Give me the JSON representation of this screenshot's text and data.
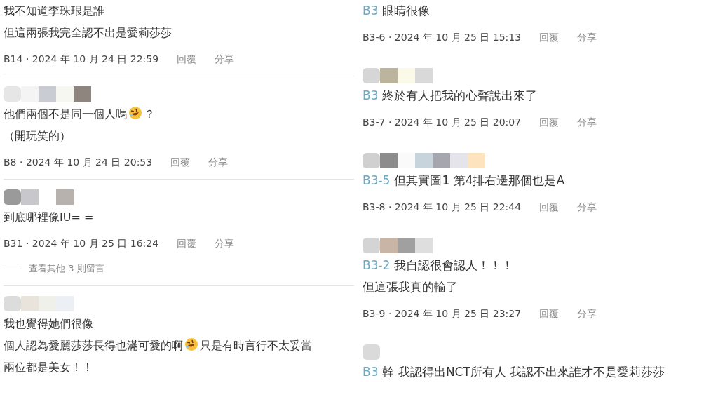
{
  "columns": [
    {
      "comments": [
        {
          "redacted_name": false,
          "divider": true,
          "lines": [
            [
              {
                "kind": "text",
                "text": "我不知道李珠珢是誰"
              }
            ],
            [
              {
                "kind": "text",
                "text": "但這兩張我完全認不出是愛莉莎莎"
              }
            ]
          ],
          "meta": {
            "floor": "B14",
            "separator": "·",
            "date": "2024 年 10 月 24 日 22:59",
            "reply": "回覆",
            "share": "分享"
          }
        },
        {
          "redacted_name": true,
          "divider": true,
          "lines": [
            [
              {
                "kind": "text",
                "text": "他們兩個不是同一個人嗎"
              },
              {
                "kind": "emoji"
              },
              {
                "kind": "text",
                "text": "？"
              }
            ],
            [
              {
                "kind": "text",
                "text": "（開玩笑的）"
              }
            ]
          ],
          "meta": {
            "floor": "B8",
            "separator": "·",
            "date": "2024 年 10 月 24 日 20:53",
            "reply": "回覆",
            "share": "分享"
          }
        },
        {
          "redacted_name": true,
          "divider": true,
          "lines": [
            [
              {
                "kind": "text",
                "text": "到底哪裡像IU= ="
              }
            ]
          ],
          "meta": {
            "floor": "B31",
            "separator": "·",
            "date": "2024 年 10 月 25 日 16:24",
            "reply": "回覆",
            "share": "分享"
          },
          "more_replies": "查看其他 3 則留言"
        },
        {
          "redacted_name": true,
          "divider": false,
          "lines": [
            [
              {
                "kind": "text",
                "text": "我也覺得她們很像"
              }
            ],
            [
              {
                "kind": "text",
                "text": "個人認為愛麗莎莎長得也滿可愛的啊"
              },
              {
                "kind": "emoji"
              },
              {
                "kind": "text",
                "text": "只是有時言行不太妥當"
              }
            ],
            [
              {
                "kind": "text",
                "text": "兩位都是美女！！"
              }
            ]
          ]
        }
      ]
    },
    {
      "comments": [
        {
          "redacted_name": false,
          "divider": false,
          "lines": [
            [
              {
                "kind": "mention",
                "text": "B3"
              },
              {
                "kind": "text",
                "text": "眼睛很像"
              }
            ]
          ],
          "meta": {
            "floor": "B3-6",
            "separator": "·",
            "date": "2024 年 10 月 25 日 15:13",
            "reply": "回覆",
            "share": "分享"
          }
        },
        {
          "redacted_name": true,
          "divider": false,
          "lines": [
            [
              {
                "kind": "mention",
                "text": "B3"
              },
              {
                "kind": "text",
                "text": "終於有人把我的心聲說出來了"
              }
            ]
          ],
          "meta": {
            "floor": "B3-7",
            "separator": "·",
            "date": "2024 年 10 月 25 日 20:07",
            "reply": "回覆",
            "share": "分享"
          }
        },
        {
          "redacted_name": true,
          "divider": false,
          "lines": [
            [
              {
                "kind": "mention",
                "text": "B3-5"
              },
              {
                "kind": "text",
                "text": "但其實圖1 第4排右邊那個也是A"
              }
            ]
          ],
          "meta": {
            "floor": "B3-8",
            "separator": "·",
            "date": "2024 年 10 月 25 日 22:44",
            "reply": "回覆",
            "share": "分享"
          }
        },
        {
          "redacted_name": true,
          "divider": false,
          "lines": [
            [
              {
                "kind": "mention",
                "text": "B3-2"
              },
              {
                "kind": "text",
                "text": "我自認很會認人！！！"
              }
            ],
            [
              {
                "kind": "text",
                "text": "但這張我真的輸了"
              }
            ]
          ],
          "meta": {
            "floor": "B3-9",
            "separator": "·",
            "date": "2024 年 10 月 25 日 23:27",
            "reply": "回覆",
            "share": "分享"
          }
        },
        {
          "redacted_name": true,
          "divider": false,
          "lines": [
            [
              {
                "kind": "mention",
                "text": "B3"
              },
              {
                "kind": "text",
                "text": "幹 我認得出NCT所有人 我認不出來誰才不是愛莉莎莎"
              }
            ]
          ]
        }
      ]
    }
  ]
}
